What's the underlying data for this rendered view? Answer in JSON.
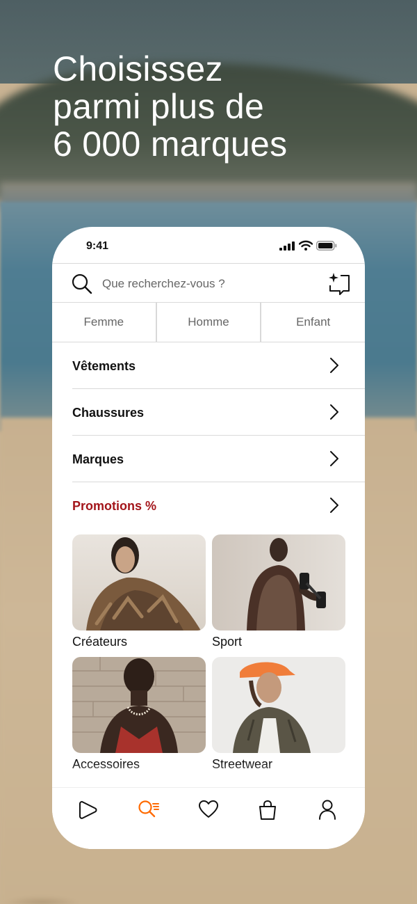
{
  "headline": {
    "line1": "Choisissez",
    "line2": "parmi plus de",
    "line3": "6 000 marques"
  },
  "status_bar": {
    "time": "9:41"
  },
  "search": {
    "placeholder": "Que recherchez-vous ?"
  },
  "gender_tabs": [
    "Femme",
    "Homme",
    "Enfant"
  ],
  "categories": [
    {
      "label": "Vêtements"
    },
    {
      "label": "Chaussures"
    },
    {
      "label": "Marques"
    },
    {
      "label": "Promotions %"
    }
  ],
  "tiles": [
    {
      "label": "Créateurs"
    },
    {
      "label": "Sport"
    },
    {
      "label": "Accessoires"
    },
    {
      "label": "Streetwear"
    }
  ],
  "tab_bar": {
    "items": [
      "play-icon",
      "search-icon",
      "heart-icon",
      "bag-icon",
      "profile-icon"
    ],
    "active": "search-icon"
  },
  "colors": {
    "promo": "#a3151a",
    "accent": "#ff6a00",
    "text": "#111111",
    "muted": "#666666",
    "divider": "#d9d9d9"
  }
}
